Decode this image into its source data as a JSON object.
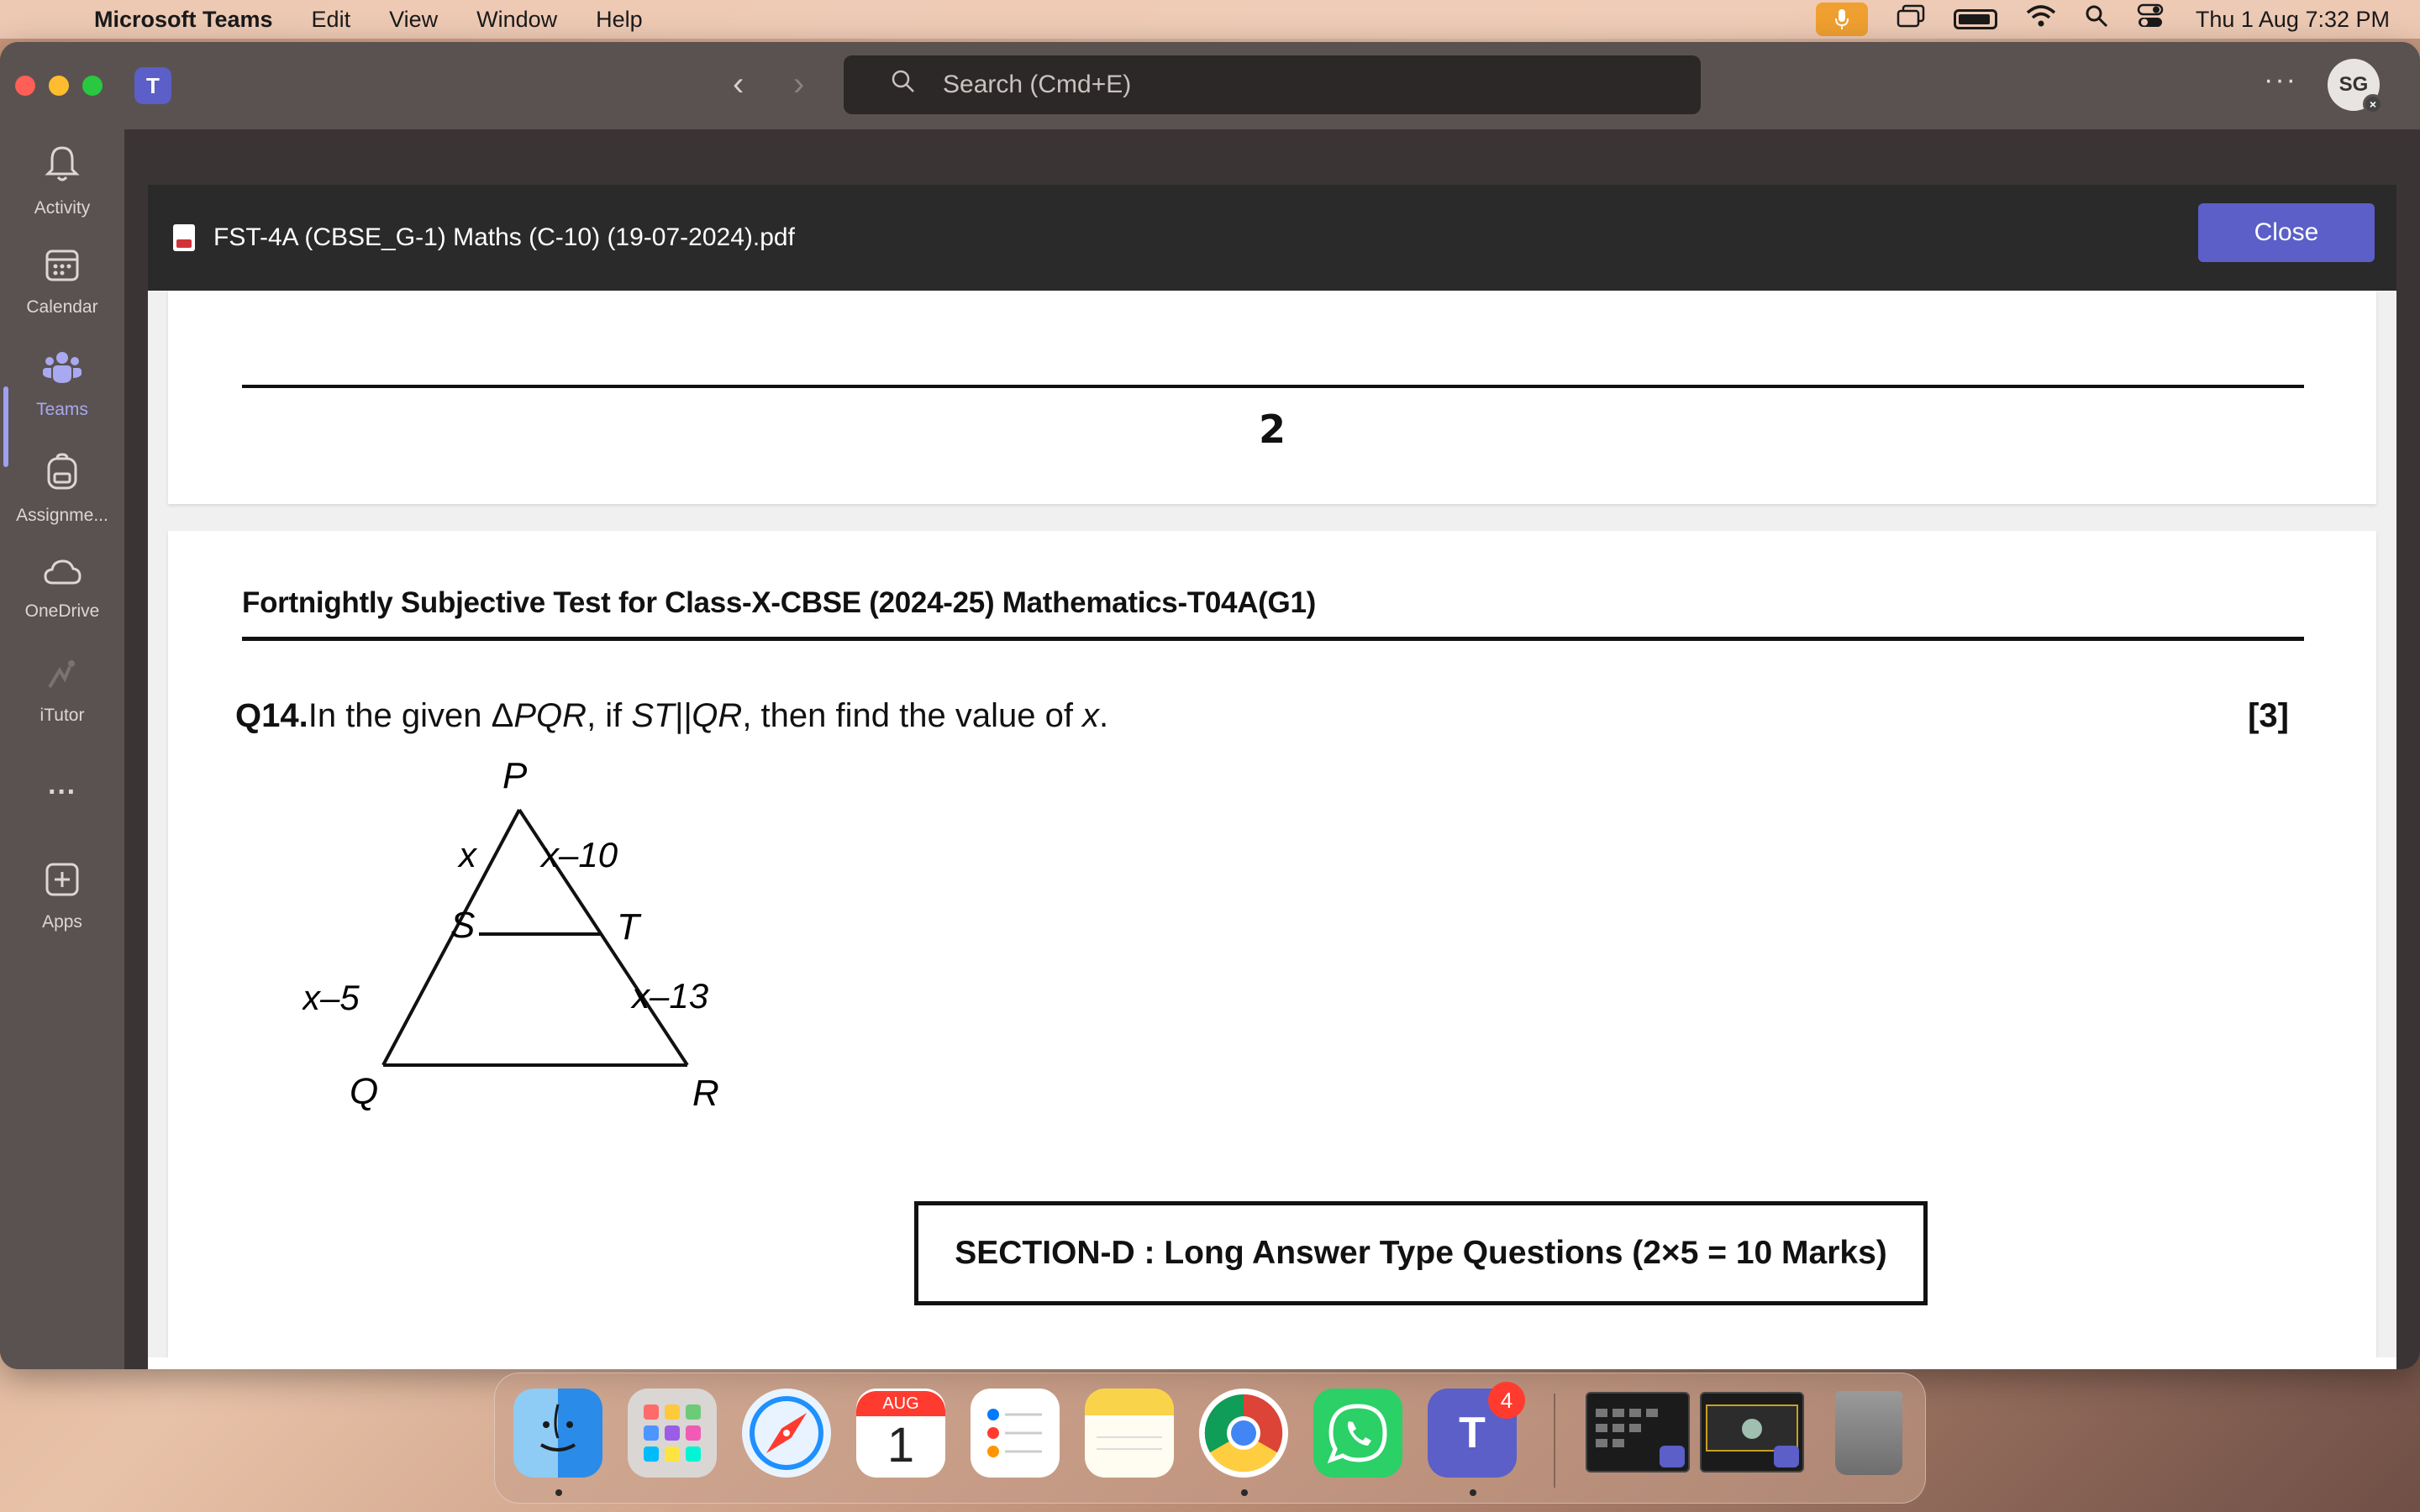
{
  "menubar": {
    "app_name": "Microsoft Teams",
    "items": [
      "Edit",
      "View",
      "Window",
      "Help"
    ],
    "clock": "Thu 1 Aug  7:32 PM"
  },
  "titlebar": {
    "search_placeholder": "Search (Cmd+E)",
    "more": "···",
    "avatar_initials": "SG"
  },
  "rail": [
    {
      "label": "Activity",
      "icon": "bell-icon"
    },
    {
      "label": "Calendar",
      "icon": "calendar-icon"
    },
    {
      "label": "Teams",
      "icon": "teams-icon",
      "active": true
    },
    {
      "label": "Assignme...",
      "icon": "backpack-icon"
    },
    {
      "label": "OneDrive",
      "icon": "cloud-icon"
    },
    {
      "label": "iTutor",
      "icon": "itutor-icon"
    },
    {
      "label": "···",
      "icon": "more-icon"
    },
    {
      "label": "Apps",
      "icon": "plus-square-icon"
    }
  ],
  "viewer": {
    "file_name": "FST-4A (CBSE_G-1) Maths (C-10) (19-07-2024).pdf",
    "close_label": "Close"
  },
  "document": {
    "page_number": "2",
    "test_title": "Fortnightly Subjective Test for Class-X-CBSE (2024-25) Mathematics-T04A(G1)",
    "question_number": "Q14.",
    "question_text_1": "In the given Δ",
    "question_pqr": "PQR",
    "question_text_2": ", if ",
    "question_st_qr": "ST||QR",
    "question_text_3": ", then find the value of ",
    "question_x": "x",
    "question_text_4": ".",
    "marks": "[3]",
    "figure_labels": {
      "P": "P",
      "S": "S",
      "T": "T",
      "Q": "Q",
      "R": "R",
      "PS": "x",
      "PT": "x–10",
      "SQ": "x–5",
      "TR": "x–13"
    },
    "section_heading": "SECTION-D : Long Answer Type Questions (2×5 = 10 Marks)"
  },
  "dock": {
    "calendar_month": "AUG",
    "calendar_day": "1",
    "teams_badge": "4"
  },
  "colors": {
    "teams_accent": "#5b5fc7",
    "rail_active": "#a8a9f0",
    "badge_red": "#ff3b30"
  }
}
